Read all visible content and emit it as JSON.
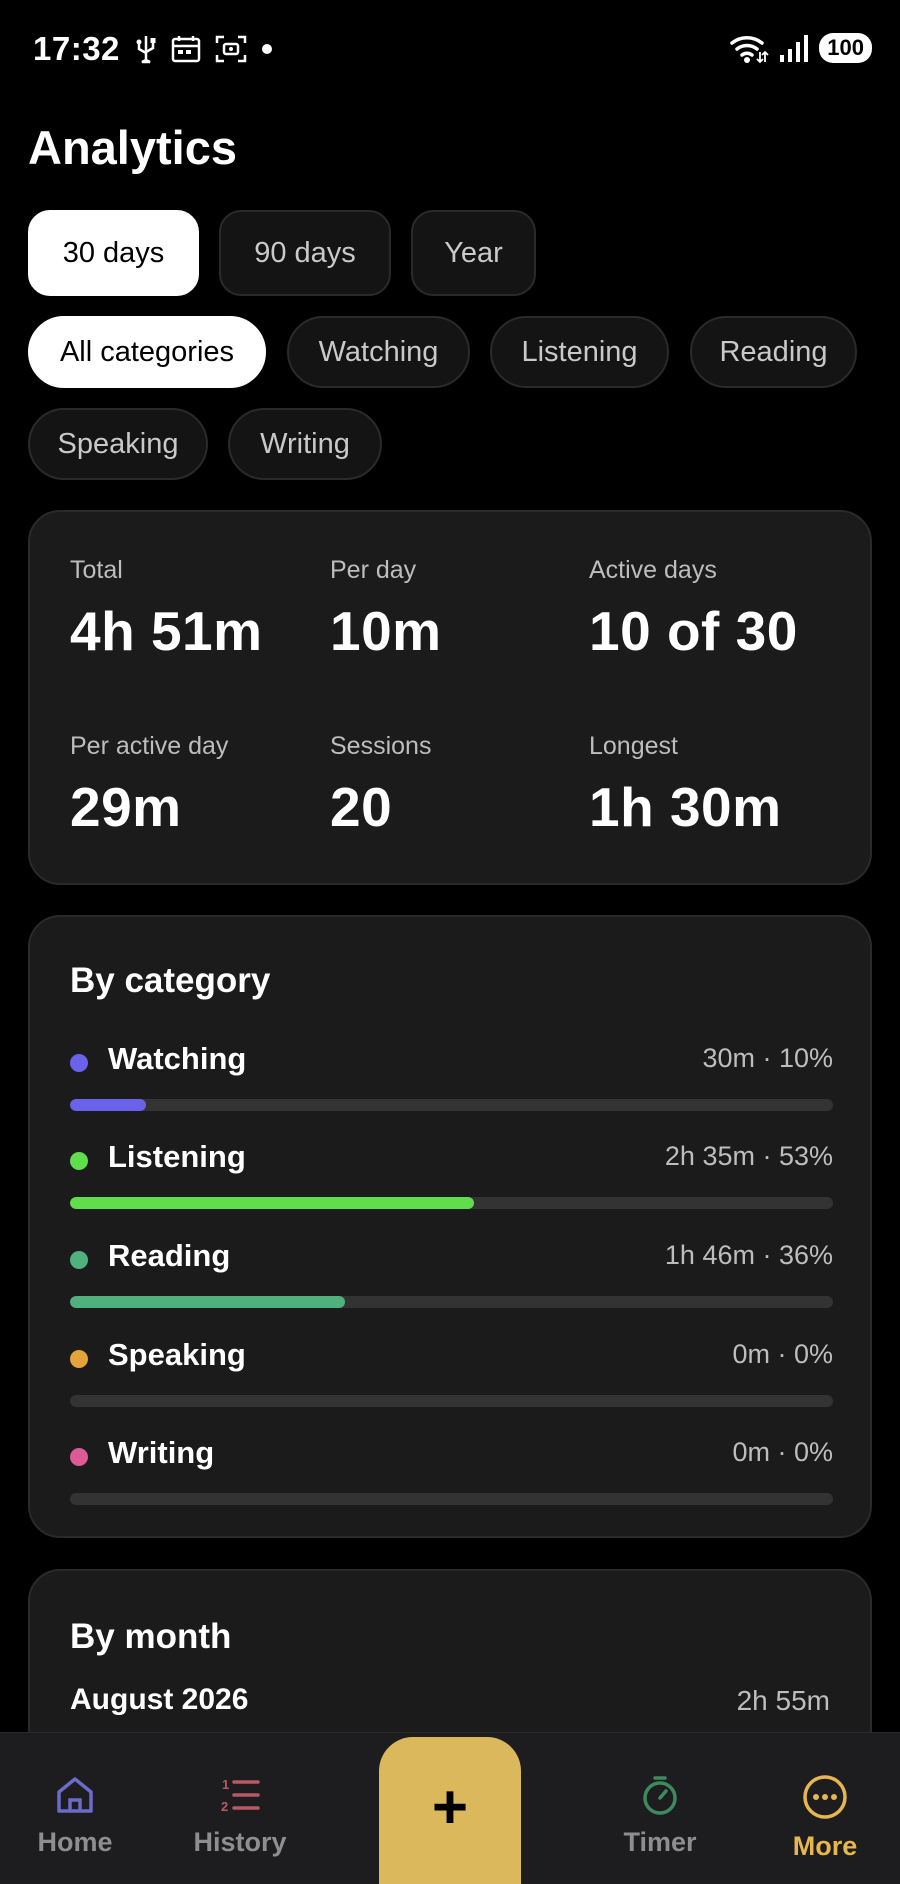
{
  "status_bar": {
    "time": "17:32",
    "battery": "100",
    "icons": [
      "usb-icon",
      "calendar-icon",
      "screenshot-icon",
      "dot-icon",
      "wifi-icon",
      "signal-icon"
    ]
  },
  "page": {
    "title": "Analytics"
  },
  "range_tabs": [
    {
      "label": "30 days",
      "selected": true
    },
    {
      "label": "90 days",
      "selected": false
    },
    {
      "label": "Year",
      "selected": false
    }
  ],
  "category_filters": [
    {
      "label": "All categories",
      "selected": true
    },
    {
      "label": "Watching",
      "selected": false
    },
    {
      "label": "Listening",
      "selected": false
    },
    {
      "label": "Reading",
      "selected": false
    },
    {
      "label": "Speaking",
      "selected": false
    },
    {
      "label": "Writing",
      "selected": false
    }
  ],
  "summary": {
    "stats": [
      {
        "label": "Total",
        "value": "4h 51m"
      },
      {
        "label": "Per day",
        "value": "10m"
      },
      {
        "label": "Active days",
        "value": "10 of 30"
      },
      {
        "label": "Per active day",
        "value": "29m"
      },
      {
        "label": "Sessions",
        "value": "20"
      },
      {
        "label": "Longest",
        "value": "1h 30m"
      }
    ]
  },
  "by_category": {
    "title": "By category",
    "items": [
      {
        "name": "Watching",
        "value": "30m · 10%",
        "percent": 10,
        "color": "#6a62ea"
      },
      {
        "name": "Listening",
        "value": "2h 35m · 53%",
        "percent": 53,
        "color": "#5fdd4a"
      },
      {
        "name": "Reading",
        "value": "1h 46m · 36%",
        "percent": 36,
        "color": "#4fb27e"
      },
      {
        "name": "Speaking",
        "value": "0m · 0%",
        "percent": 0,
        "color": "#e3a43b"
      },
      {
        "name": "Writing",
        "value": "0m · 0%",
        "percent": 0,
        "color": "#dc5a95"
      }
    ]
  },
  "by_month": {
    "title": "By month",
    "rows": [
      {
        "month": "August 2026",
        "value": "2h 55m"
      }
    ]
  },
  "bottom_nav": {
    "items": [
      {
        "label": "Home",
        "icon": "home-icon",
        "color": "#6b6bc9"
      },
      {
        "label": "History",
        "icon": "numbered-list-icon",
        "color": "#b85a63"
      },
      {
        "label": "Timer",
        "icon": "stopwatch-icon",
        "color": "#3d8a5e"
      },
      {
        "label": "More",
        "icon": "more-icon",
        "color": "#e5b74e",
        "active": true
      }
    ],
    "fab_label": "+"
  },
  "colors": {
    "background": "#000000",
    "card": "#1b1b1c",
    "accent": "#dcb85c",
    "muted_text": "#bdbdbd"
  }
}
